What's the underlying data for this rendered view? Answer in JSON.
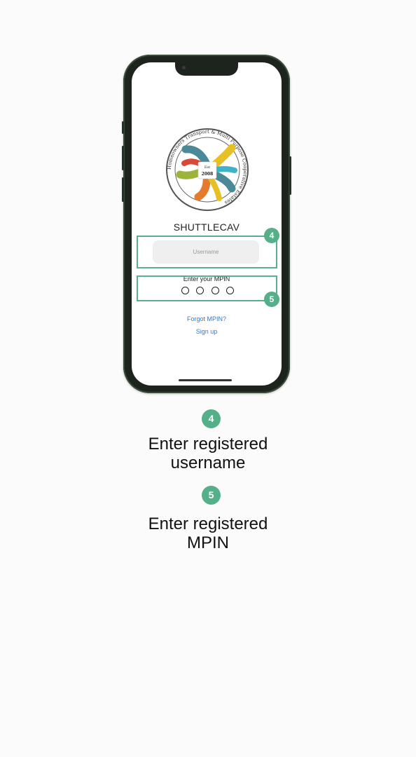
{
  "screen": {
    "app_name": "SHUTTLECAV",
    "username_placeholder": "Username",
    "mpin_label": "Enter your MPIN",
    "forgot_link": "Forgot MPIN?",
    "signup_link": "Sign up",
    "logo": {
      "est": "Est",
      "year": "2008",
      "ring_words": [
        "Transport",
        "&",
        "Multi",
        "Purpose",
        "Cooperative",
        "Co-op",
        "Estates",
        "Homeowners"
      ]
    }
  },
  "steps": [
    {
      "number": "4",
      "title_line1": "Enter registered",
      "title_line2": "username"
    },
    {
      "number": "5",
      "title_line1": "Enter registered",
      "title_line2": "MPIN"
    }
  ],
  "colors": {
    "accent": "#55b08a",
    "link": "#3a78c4"
  }
}
